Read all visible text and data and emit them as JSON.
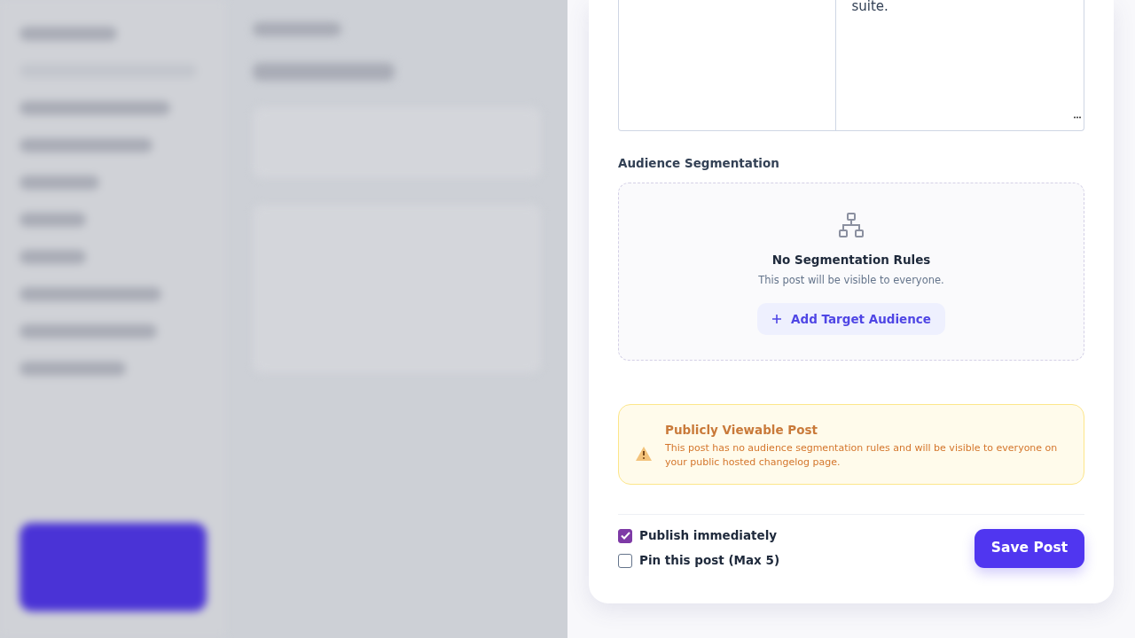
{
  "editor": {
    "right_column_text": "suite."
  },
  "audience_segmentation": {
    "label": "Audience Segmentation",
    "empty_title": "No Segmentation Rules",
    "empty_text": "This post will be visible to everyone.",
    "add_button": "Add Target Audience"
  },
  "warning": {
    "title": "Publicly Viewable Post",
    "text": "This post has no audience segmentation rules and will be visible to everyone on your public hosted changelog page."
  },
  "options": [
    {
      "label": "Publish immediately",
      "checked": true
    },
    {
      "label": "Pin this post (Max 5)",
      "checked": false
    }
  ],
  "save_button": "Save Post"
}
